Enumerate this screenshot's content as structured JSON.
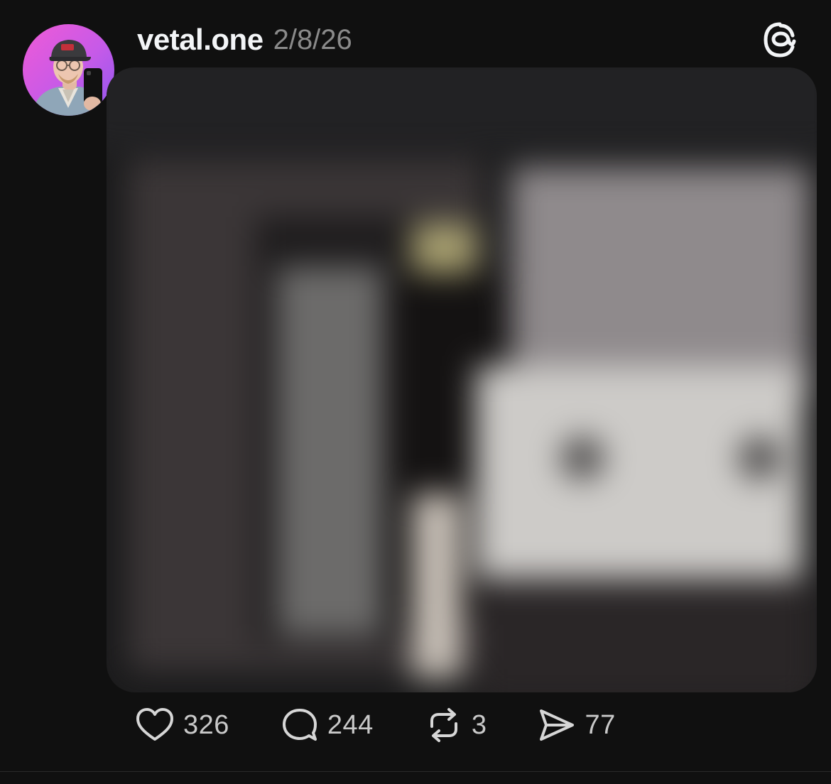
{
  "post": {
    "username": "vetal.one",
    "timestamp": "2/8/26",
    "avatar_icon": "user-avatar",
    "app_icon": "threads-logo-icon",
    "media_description_hidden": true
  },
  "actions": {
    "likes": "326",
    "replies": "244",
    "reposts": "3",
    "shares": "77"
  },
  "colors": {
    "background": "#101010",
    "text_primary": "#f3f5f7",
    "text_secondary": "#8a8a8a",
    "avatar_gradient_start": "#f05bd6",
    "avatar_gradient_end": "#8f57f0"
  }
}
